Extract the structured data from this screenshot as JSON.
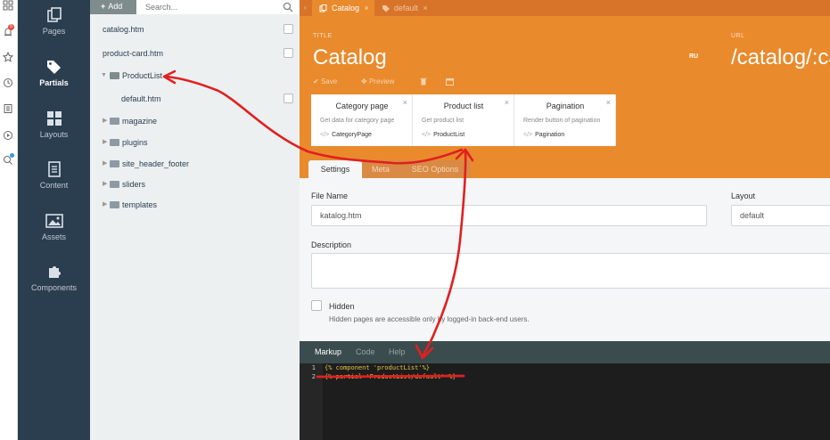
{
  "icon_strip": {
    "icons": [
      "apps-icon",
      "bell-icon",
      "star-icon",
      "clock-icon",
      "list-icon",
      "play-icon",
      "search-user-icon"
    ],
    "notification_count": "5"
  },
  "nav": {
    "items": [
      {
        "label": "Pages",
        "icon": "pages-icon"
      },
      {
        "label": "Partials",
        "icon": "tags-icon"
      },
      {
        "label": "Layouts",
        "icon": "layouts-icon"
      },
      {
        "label": "Content",
        "icon": "content-icon"
      },
      {
        "label": "Assets",
        "icon": "assets-icon"
      },
      {
        "label": "Components",
        "icon": "puzzle-icon"
      }
    ],
    "active": "Partials"
  },
  "tree": {
    "add_label": "Add",
    "search_placeholder": "Search...",
    "rows": [
      {
        "label": "catalog.htm",
        "type": "file"
      },
      {
        "label": "product-card.htm",
        "type": "file"
      },
      {
        "label": "ProductList",
        "type": "folder-open"
      },
      {
        "label": "default.htm",
        "type": "file-child"
      },
      {
        "label": "magazine",
        "type": "folder"
      },
      {
        "label": "plugins",
        "type": "folder"
      },
      {
        "label": "site_header_footer",
        "type": "folder"
      },
      {
        "label": "sliders",
        "type": "folder"
      },
      {
        "label": "templates",
        "type": "folder"
      }
    ]
  },
  "tabs": {
    "active": "Catalog",
    "inactive": "default"
  },
  "header": {
    "title_label": "TITLE",
    "title": "Catalog",
    "lang": "RU",
    "url_label": "URL",
    "url": "/catalog/:ca",
    "save_label": "Save",
    "preview_label": "Preview"
  },
  "components": [
    {
      "name": "Category page",
      "desc": "Get data for category page",
      "alias": "CategoryPage"
    },
    {
      "name": "Product list",
      "desc": "Get product list",
      "alias": "ProductList"
    },
    {
      "name": "Pagination",
      "desc": "Render button of pagination",
      "alias": "Pagination"
    }
  ],
  "sub_tabs": [
    "Settings",
    "Meta",
    "SEO Options"
  ],
  "form": {
    "file_name_label": "File Name",
    "file_name_value": "katalog.htm",
    "layout_label": "Layout",
    "layout_value": "default",
    "description_label": "Description",
    "hidden_label": "Hidden",
    "hidden_hint": "Hidden pages are accessible only by logged-in back-end users."
  },
  "editor": {
    "tabs": [
      "Markup",
      "Code",
      "Help"
    ],
    "lines": [
      "{% component 'productList'%}",
      "{% partial 'ProductList/default' %}"
    ]
  },
  "colors": {
    "nav_bg": "#2b3e50",
    "orange": "#e98a2c",
    "orange_dark": "#d7742a",
    "annotation_red": "#e02020"
  }
}
